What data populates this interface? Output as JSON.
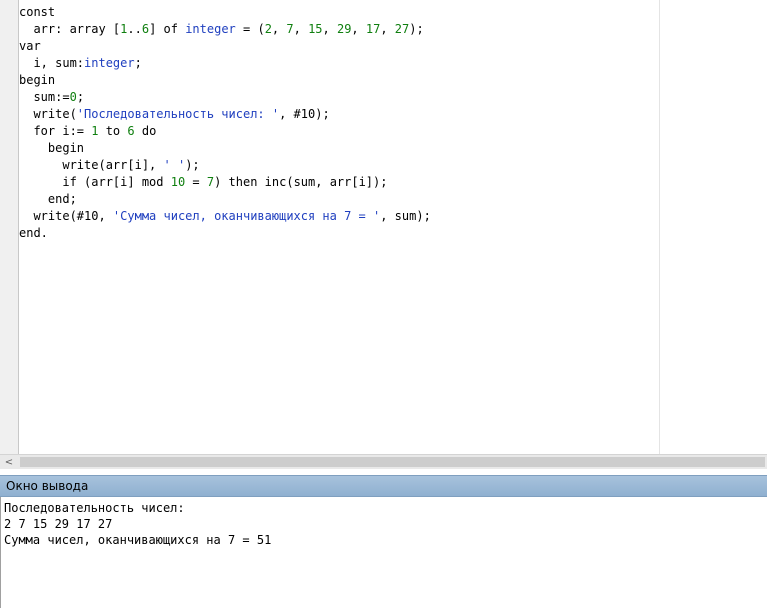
{
  "editor": {
    "lines": [
      [
        {
          "t": "const",
          "c": "kw"
        }
      ],
      [
        {
          "t": "  arr: array [",
          "c": "id"
        },
        {
          "t": "1",
          "c": "num"
        },
        {
          "t": "..",
          "c": "sym"
        },
        {
          "t": "6",
          "c": "num"
        },
        {
          "t": "] of ",
          "c": "id"
        },
        {
          "t": "integer",
          "c": "type"
        },
        {
          "t": " = (",
          "c": "sym"
        },
        {
          "t": "2",
          "c": "num"
        },
        {
          "t": ", ",
          "c": "sym"
        },
        {
          "t": "7",
          "c": "num"
        },
        {
          "t": ", ",
          "c": "sym"
        },
        {
          "t": "15",
          "c": "num"
        },
        {
          "t": ", ",
          "c": "sym"
        },
        {
          "t": "29",
          "c": "num"
        },
        {
          "t": ", ",
          "c": "sym"
        },
        {
          "t": "17",
          "c": "num"
        },
        {
          "t": ", ",
          "c": "sym"
        },
        {
          "t": "27",
          "c": "num"
        },
        {
          "t": ");",
          "c": "sym"
        }
      ],
      [
        {
          "t": "var",
          "c": "kw"
        }
      ],
      [
        {
          "t": "  i, sum:",
          "c": "id"
        },
        {
          "t": "integer",
          "c": "type"
        },
        {
          "t": ";",
          "c": "sym"
        }
      ],
      [
        {
          "t": "begin",
          "c": "kw"
        }
      ],
      [
        {
          "t": "  sum:=",
          "c": "id"
        },
        {
          "t": "0",
          "c": "num"
        },
        {
          "t": ";",
          "c": "sym"
        }
      ],
      [
        {
          "t": "  write(",
          "c": "id"
        },
        {
          "t": "'Последовательность чисел: '",
          "c": "str"
        },
        {
          "t": ", #10);",
          "c": "sym"
        }
      ],
      [
        {
          "t": "  for i:= ",
          "c": "kw"
        },
        {
          "t": "1",
          "c": "num"
        },
        {
          "t": " to ",
          "c": "kw"
        },
        {
          "t": "6",
          "c": "num"
        },
        {
          "t": " do",
          "c": "kw"
        }
      ],
      [
        {
          "t": "    begin",
          "c": "kw"
        }
      ],
      [
        {
          "t": "      write(arr[i], ",
          "c": "id"
        },
        {
          "t": "' '",
          "c": "str"
        },
        {
          "t": ");",
          "c": "sym"
        }
      ],
      [
        {
          "t": "      if (arr[i] mod ",
          "c": "id"
        },
        {
          "t": "10",
          "c": "num"
        },
        {
          "t": " = ",
          "c": "sym"
        },
        {
          "t": "7",
          "c": "num"
        },
        {
          "t": ") then inc(sum, arr[i]);",
          "c": "id"
        }
      ],
      [
        {
          "t": "    end;",
          "c": "kw"
        }
      ],
      [
        {
          "t": "  write(#10, ",
          "c": "id"
        },
        {
          "t": "'Сумма чисел, оканчивающихся на 7 = '",
          "c": "str"
        },
        {
          "t": ", sum);",
          "c": "sym"
        }
      ],
      [
        {
          "t": "end.",
          "c": "kw"
        }
      ]
    ]
  },
  "scrollbar": {
    "left_arrow": "<"
  },
  "output": {
    "title": "Окно вывода",
    "lines": [
      "Последовательность чисел:",
      "2 7 15 29 17 27",
      "Сумма чисел, оканчивающихся на 7 = 51"
    ]
  },
  "colors": {
    "type": "#1f3fbf",
    "number": "#0f7f0f",
    "string": "#1f3fbf",
    "output_header": "#9bb9d6"
  }
}
